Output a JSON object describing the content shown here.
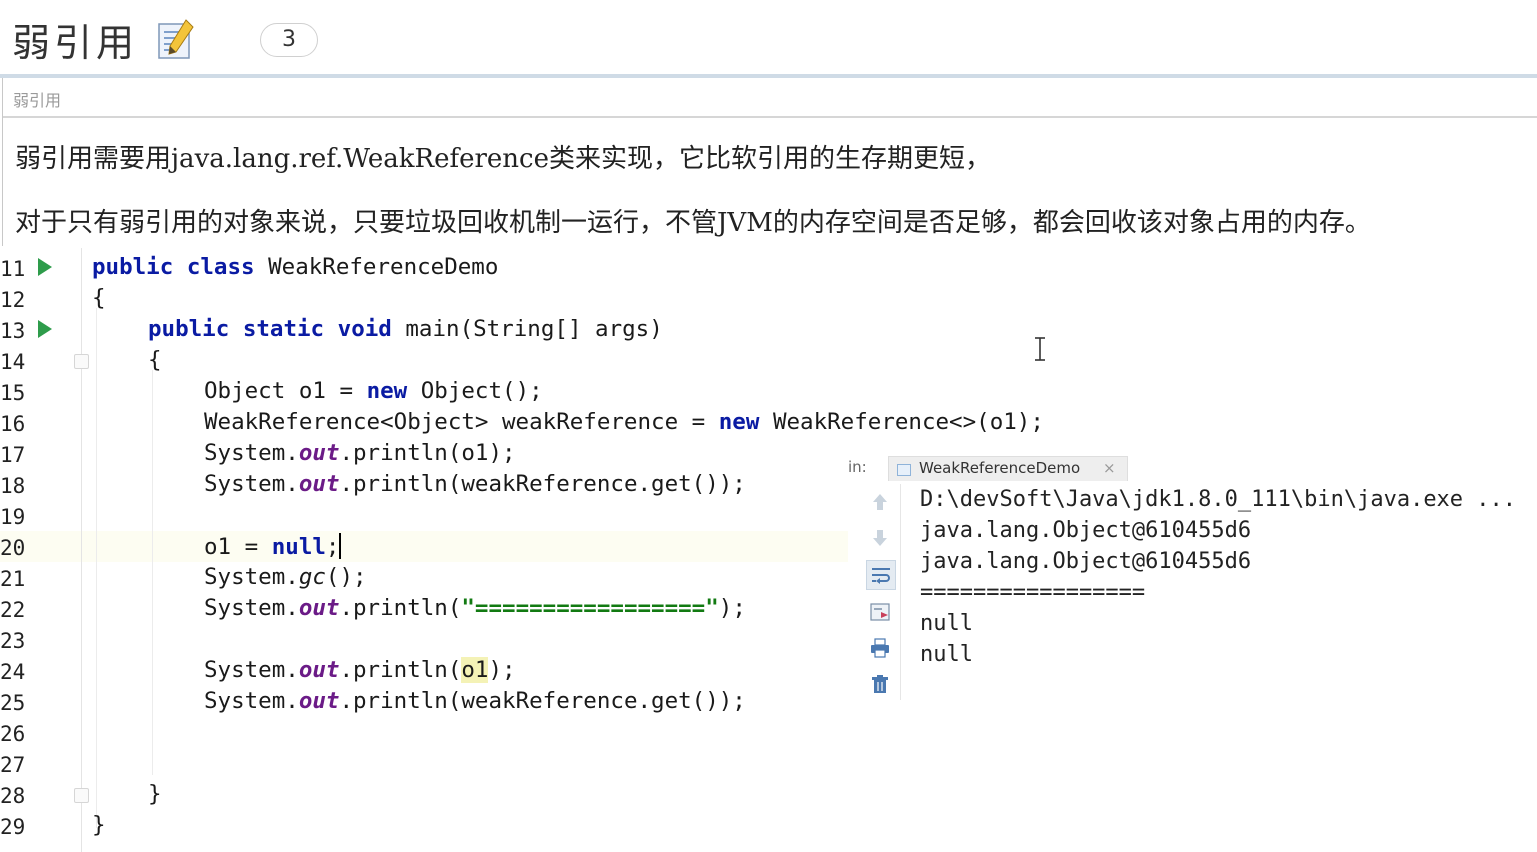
{
  "header": {
    "title": "弱引用",
    "count": "3"
  },
  "card": {
    "subtitle": "弱引用",
    "lines": [
      "弱引用需要用java.lang.ref.WeakReference类来实现，它比软引用的生存期更短，",
      "对于只有弱引用的对象来说，只要垃圾回收机制一运行，不管JVM的内存空间是否足够，都会回收该对象占用的内存。"
    ]
  },
  "editor": {
    "line_numbers": [
      "11",
      "12",
      "13",
      "14",
      "15",
      "16",
      "17",
      "18",
      "19",
      "20",
      "21",
      "22",
      "23",
      "24",
      "25",
      "26",
      "27",
      "28",
      "29"
    ],
    "code": {
      "l11": {
        "kw1": "public",
        "kw2": "class",
        "rest": " WeakReferenceDemo"
      },
      "l12": "{",
      "l13": {
        "kw1": "public",
        "kw2": "static",
        "kw3": "void",
        "rest": " main(String[] args)"
      },
      "l14": "{",
      "l15": {
        "a": "Object o1 = ",
        "kw": "new",
        "b": " Object();"
      },
      "l16": {
        "a": "WeakReference<Object> weakReference = ",
        "kw": "new",
        "b": " WeakReference<>(o1);"
      },
      "l17": {
        "a": "System.",
        "fld": "out",
        "b": ".println(o1);"
      },
      "l18": {
        "a": "System.",
        "fld": "out",
        "b": ".println(weakReference.get());"
      },
      "l20": {
        "a": "o1 = ",
        "kw": "null",
        "b": ";"
      },
      "l21": {
        "a": "System.",
        "mth": "gc",
        "b": "();"
      },
      "l22": {
        "a": "System.",
        "fld": "out",
        "b": ".println(",
        "str": "\"=================\"",
        "c": ");"
      },
      "l24": {
        "a": "System.",
        "fld": "out",
        "b": ".println(",
        "hl": "o1",
        "c": ");"
      },
      "l25": {
        "a": "System.",
        "fld": "out",
        "b": ".println(weakReference.get());"
      },
      "l28": "}",
      "l29": "}"
    }
  },
  "console": {
    "tab_prefix": "in:",
    "tab_label": "WeakReferenceDemo",
    "tab_close": "×",
    "lines": [
      "D:\\devSoft\\Java\\jdk1.8.0_111\\bin\\java.exe ...",
      "java.lang.Object@610455d6",
      "java.lang.Object@610455d6",
      "=================",
      "null",
      "null"
    ]
  },
  "colors": {
    "keyword": "#0a1ba3",
    "field": "#6b1b87",
    "string": "#127a12",
    "run": "#2e9c4b"
  },
  "icons": [
    "note-icon",
    "run-arrow-icon",
    "fold-icon",
    "text-cursor-icon",
    "arrow-up-icon",
    "arrow-down-icon",
    "soft-wrap-icon",
    "scroll-to-end-icon",
    "print-icon",
    "trash-icon"
  ]
}
